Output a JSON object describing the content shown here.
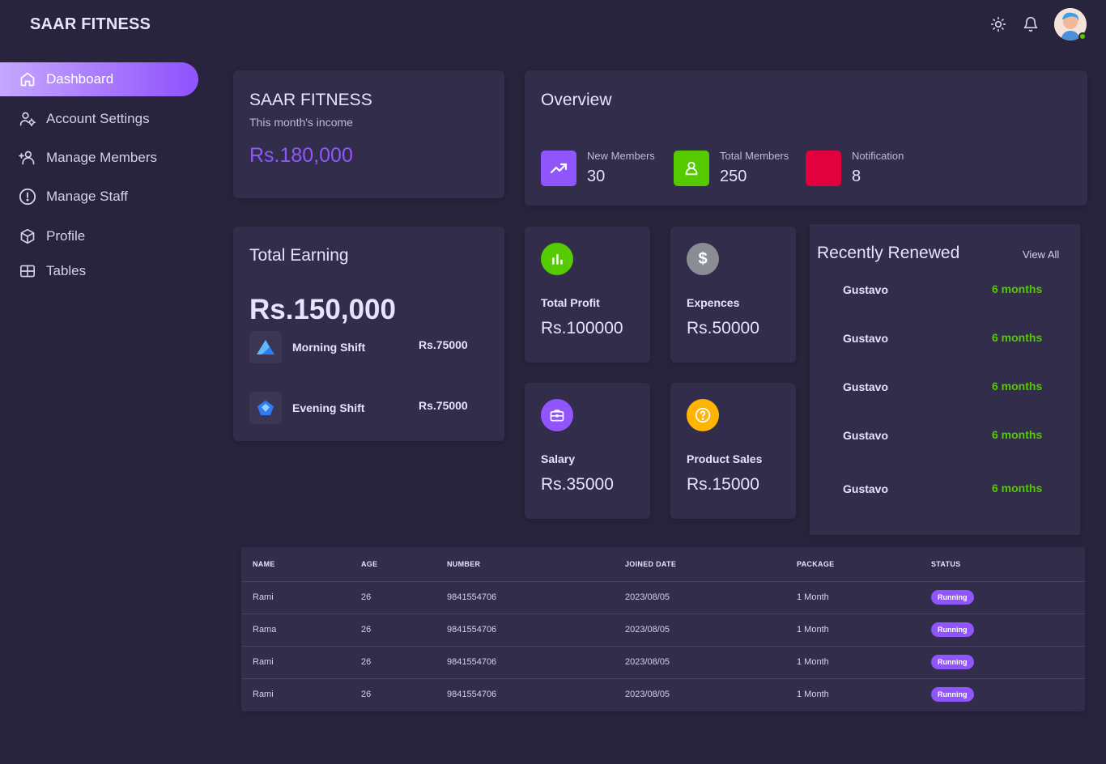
{
  "header": {
    "brand": "SAAR FITNESS",
    "icons": [
      "sun-icon",
      "bell-icon"
    ],
    "avatar_status_color": "#56ca00"
  },
  "sidebar": {
    "items": [
      {
        "label": "Dashboard",
        "icon": "home-icon",
        "active": true
      },
      {
        "label": "Account Settings",
        "icon": "user-cog-icon"
      },
      {
        "label": "Manage Members",
        "icon": "user-plus-icon"
      },
      {
        "label": "Manage Staff",
        "icon": "alert-circle-icon"
      },
      {
        "label": "Profile",
        "icon": "cube-icon"
      },
      {
        "label": "Tables",
        "icon": "table-icon"
      }
    ]
  },
  "income_card": {
    "title": "SAAR FITNESS",
    "subtitle": "This month's income",
    "amount": "Rs.180,000"
  },
  "overview": {
    "title": "Overview",
    "stats": [
      {
        "label": "New Members",
        "value": "30",
        "color": "#9155fd",
        "icon": "trending-up-icon"
      },
      {
        "label": "Total Members",
        "value": "250",
        "color": "#56ca00",
        "icon": "user-icon"
      },
      {
        "label": "Notification",
        "value": "8",
        "color": "#e2003f",
        "icon": ""
      }
    ]
  },
  "earning": {
    "title": "Total Earning",
    "amount": "Rs.150,000",
    "shifts": [
      {
        "name": "Morning Shift",
        "amount": "Rs.75000"
      },
      {
        "name": "Evening Shift",
        "amount": "Rs.75000"
      }
    ]
  },
  "mini_cards": [
    {
      "label": "Total Profit",
      "value": "Rs.100000",
      "color": "#56ca00",
      "icon": "bar-chart-icon"
    },
    {
      "label": "Expences",
      "value": "Rs.50000",
      "color": "#8a8d93",
      "icon": "dollar-icon"
    },
    {
      "label": "Salary",
      "value": "Rs.35000",
      "color": "#9155fd",
      "icon": "briefcase-icon"
    },
    {
      "label": "Product Sales",
      "value": "Rs.15000",
      "color": "#ffb400",
      "icon": "help-circle-icon"
    }
  ],
  "renewed": {
    "title": "Recently Renewed",
    "view_all": "View All",
    "items": [
      {
        "name": "Gustavo",
        "period": "6 months"
      },
      {
        "name": "Gustavo",
        "period": "6 months"
      },
      {
        "name": "Gustavo",
        "period": "6 months"
      },
      {
        "name": "Gustavo",
        "period": "6 months"
      },
      {
        "name": "Gustavo",
        "period": "6 months"
      }
    ]
  },
  "table": {
    "headers": [
      "NAME",
      "AGE",
      "NUMBER",
      "JOINED DATE",
      "PACKAGE",
      "STATUS"
    ],
    "rows": [
      {
        "name": "Rami",
        "age": "26",
        "number": "9841554706",
        "joined": "2023/08/05",
        "package": "1 Month",
        "status": "Running"
      },
      {
        "name": "Rama",
        "age": "26",
        "number": "9841554706",
        "joined": "2023/08/05",
        "package": "1 Month",
        "status": "Running"
      },
      {
        "name": "Rami",
        "age": "26",
        "number": "9841554706",
        "joined": "2023/08/05",
        "package": "1 Month",
        "status": "Running"
      },
      {
        "name": "Rami",
        "age": "26",
        "number": "9841554706",
        "joined": "2023/08/05",
        "package": "1 Month",
        "status": "Running"
      }
    ]
  }
}
